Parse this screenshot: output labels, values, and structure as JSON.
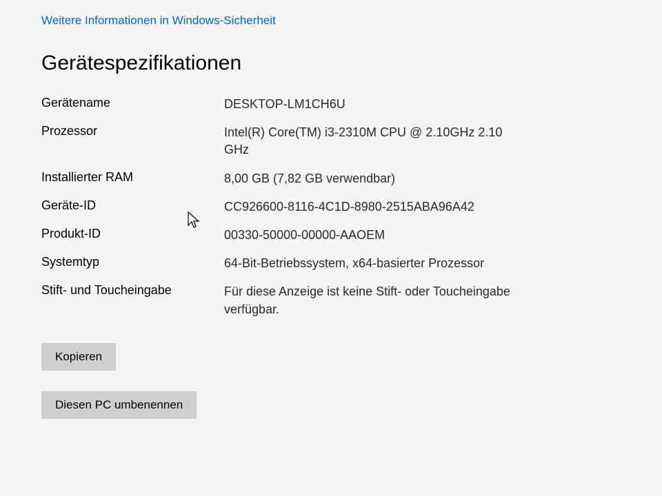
{
  "link": {
    "text": "Weitere Informationen in Windows-Sicherheit"
  },
  "section": {
    "title": "Gerätespezifikationen"
  },
  "specs": {
    "deviceName": {
      "label": "Gerätename",
      "value": "DESKTOP-LM1CH6U"
    },
    "processor": {
      "label": "Prozessor",
      "value": "Intel(R) Core(TM) i3-2310M CPU @ 2.10GHz 2.10 GHz"
    },
    "ram": {
      "label": "Installierter RAM",
      "value": "8,00 GB (7,82 GB verwendbar)"
    },
    "deviceId": {
      "label": "Geräte-ID",
      "value": "CC926600-8116-4C1D-8980-2515ABA96A42"
    },
    "productId": {
      "label": "Produkt-ID",
      "value": "00330-50000-00000-AAOEM"
    },
    "systemType": {
      "label": "Systemtyp",
      "value": "64-Bit-Betriebssystem, x64-basierter Prozessor"
    },
    "penTouch": {
      "label": "Stift- und Toucheingabe",
      "value": "Für diese Anzeige ist keine Stift- oder Toucheingabe verfügbar."
    }
  },
  "buttons": {
    "copy": "Kopieren",
    "rename": "Diesen PC umbenennen"
  }
}
